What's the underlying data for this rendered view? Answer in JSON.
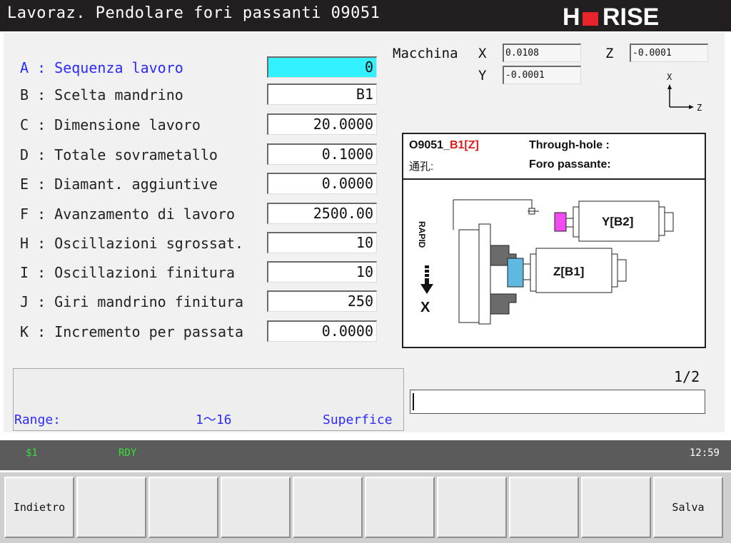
{
  "title": "Lavoraz. Pendolare fori passanti 09051",
  "brand": {
    "text": "HURISE",
    "accent": "#e8232a"
  },
  "params": [
    {
      "label": "A : Sequenza lavoro",
      "value": "0",
      "active": true
    },
    {
      "label": "B : Scelta mandrino",
      "value": "B1"
    },
    {
      "label": "C : Dimensione lavoro",
      "value": "20.0000"
    },
    {
      "label": "D : Totale sovrametallo",
      "value": "0.1000"
    },
    {
      "label": "E : Diamant. aggiuntive",
      "value": "0.0000"
    },
    {
      "label": "F : Avanzamento di lavoro",
      "value": "2500.00"
    },
    {
      "label": "H : Oscillazioni sgrossat.",
      "value": "10"
    },
    {
      "label": "I : Oscillazioni finitura",
      "value": "10"
    },
    {
      "label": "J : Giri mandrino finitura",
      "value": "250"
    },
    {
      "label": "K : Incremento per passata",
      "value": "0.0000"
    }
  ],
  "machine": {
    "label": "Macchina",
    "x_label": "X",
    "x_value": "0.0108",
    "z_label": "Z",
    "z_value": "-0.0001",
    "y_label": "Y",
    "y_value": "-0.0001"
  },
  "axis_indicator": {
    "x": "X",
    "z": "Z"
  },
  "diagram": {
    "code": "O9051_",
    "code_suffix": "B1[Z]",
    "cn_label": "通孔:",
    "title_en": "Through-hole :",
    "title_it": "Foro passante:",
    "rapid_label": "RAPID",
    "x_axis": "X",
    "spindle_y": "Y[B2]",
    "spindle_z": "Z[B1]"
  },
  "message": {
    "range_label": "Range:",
    "range_value": "1～16",
    "range_name": "Superfice"
  },
  "page_indicator": "1/2",
  "status": {
    "program": "$1",
    "state": "RDY",
    "time": "12:59"
  },
  "softkeys": [
    "Indietro",
    "",
    "",
    "",
    "",
    "",
    "",
    "",
    "",
    "Salva"
  ],
  "colors": {
    "active_field": "#33f0ff",
    "active_label": "#2b2bff",
    "status_text": "#38e038",
    "title_bg": "#231f20"
  }
}
